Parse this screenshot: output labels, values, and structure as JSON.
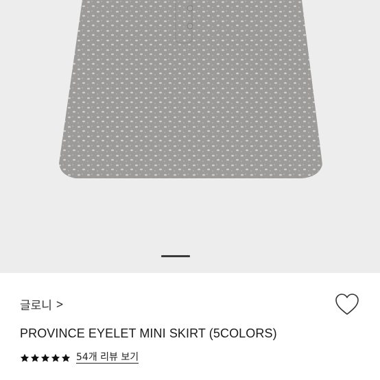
{
  "product": {
    "brand": "글로니",
    "brand_chevron": ">",
    "title": "PROVINCE EYELET MINI SKIRT (5COLORS)",
    "review_link": "54개 리뷰 보기",
    "rating_stars": 5
  },
  "gallery": {
    "active_slide_indicator": "active"
  },
  "icons": {
    "wishlist": "heart-outline-icon",
    "star": "star-filled-icon"
  },
  "colors": {
    "background_image": "#ededed",
    "skirt": "#9d9b99",
    "indicator": "#3a3a3a",
    "star": "#111111"
  }
}
